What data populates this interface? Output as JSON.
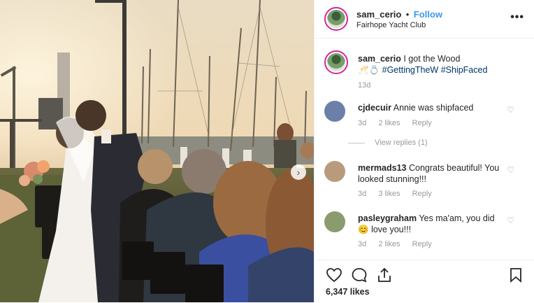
{
  "post": {
    "username": "sam_cerio",
    "separator": "•",
    "follow_label": "Follow",
    "location": "Fairhope Yacht Club",
    "more_label": "•••"
  },
  "caption": {
    "username": "sam_cerio",
    "text": "I got the Wood",
    "emoji": "🥂💍",
    "hashtags": [
      "#GettingTheW",
      "#ShipFaced"
    ],
    "time": "13d"
  },
  "comments": [
    {
      "username": "cjdecuir",
      "text": "Annie was shipfaced",
      "time": "3d",
      "likes": "2 likes",
      "reply": "Reply",
      "avatar_color": "#6c7fa8"
    },
    {
      "username": "mermads13",
      "text": "Congrats beautiful! You looked stunning!!!",
      "time": "3d",
      "likes": "3 likes",
      "reply": "Reply",
      "avatar_color": "#b89a7d"
    },
    {
      "username": "pasleygraham",
      "text": "Yes ma'am, you did",
      "emoji": "😊",
      "text2": "love you!!!",
      "time": "3d",
      "likes": "2 likes",
      "reply": "Reply",
      "avatar_color": "#8a9b6e"
    }
  ],
  "view_replies": "View replies (1)",
  "likes_count": "6,347 likes",
  "icons": {
    "heart": "heart-icon",
    "comment": "comment-icon",
    "share": "share-icon",
    "bookmark": "bookmark-icon",
    "next": "chevron-right-icon"
  },
  "colors": {
    "follow": "#3897f0",
    "hashtag": "#003569",
    "muted": "#999999",
    "avatar_ring": "#d6249f"
  }
}
